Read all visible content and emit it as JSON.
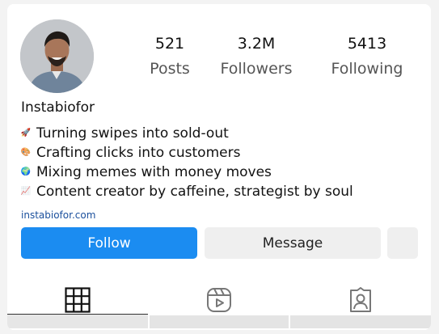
{
  "profile": {
    "username": "Instabiofor",
    "link": "instabiofor.com"
  },
  "stats": [
    {
      "value": "521",
      "label": "Posts"
    },
    {
      "value": "3.2M",
      "label": "Followers"
    },
    {
      "value": "5413",
      "label": "Following"
    }
  ],
  "bio": [
    {
      "icon": "rocket-icon",
      "glyph": "🚀",
      "text": "Turning swipes into sold-out"
    },
    {
      "icon": "palette-icon",
      "glyph": "🎨",
      "text": "Crafting clicks into customers"
    },
    {
      "icon": "globe-icon",
      "glyph": "🌍",
      "text": "Mixing memes with money moves"
    },
    {
      "icon": "chart-up-icon",
      "glyph": "📈",
      "text": "Content creator by caffeine, strategist by soul"
    }
  ],
  "buttons": {
    "follow": "Follow",
    "message": "Message"
  },
  "tabs": [
    {
      "name": "posts-grid",
      "icon": "grid-icon",
      "active": true
    },
    {
      "name": "reels",
      "icon": "reels-icon",
      "active": false
    },
    {
      "name": "tagged",
      "icon": "tagged-person-icon",
      "active": false
    }
  ],
  "colors": {
    "follow_button": "#1b8cf1",
    "secondary_button": "#efefef",
    "link": "#1a4f9c"
  }
}
